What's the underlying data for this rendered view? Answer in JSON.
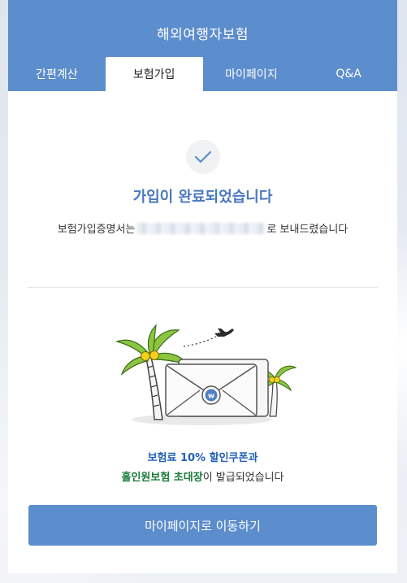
{
  "header": {
    "title": "해외여행자보험",
    "tabs": [
      {
        "label": "간편계산",
        "active": false
      },
      {
        "label": "보험가입",
        "active": true
      },
      {
        "label": "마이페이지",
        "active": false
      },
      {
        "label": "Q&A",
        "active": false
      }
    ]
  },
  "result": {
    "icon": "check-icon",
    "title": "가입이 완료되었습니다",
    "sent_prefix": "보험가입증명서는",
    "sent_suffix": "로 보내드렸습니다"
  },
  "coupon": {
    "line1": "보험료 10% 할인쿠폰과",
    "line2_highlight": "홀인원보험 초대장",
    "line2_suffix": "이 발급되었습니다"
  },
  "cta": {
    "label": "마이페이지로 이동하기"
  },
  "colors": {
    "brand": "#5c8dcd",
    "title_blue": "#4a78c2",
    "coupon_blue": "#1f5fb8",
    "coupon_green": "#1a7a3b"
  }
}
